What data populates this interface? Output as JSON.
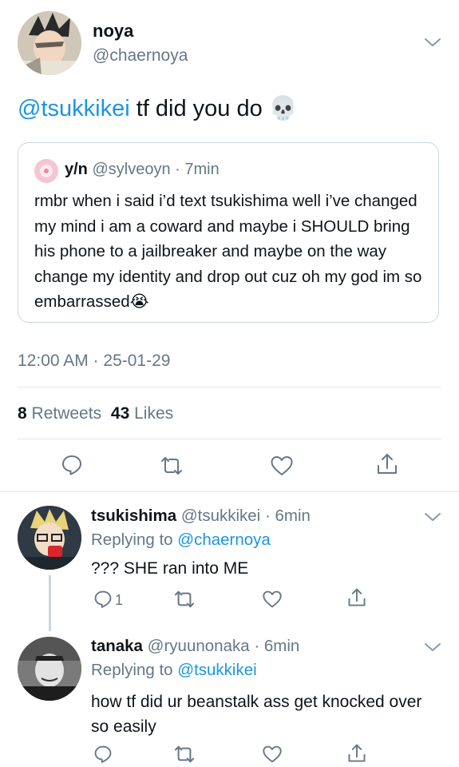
{
  "main_tweet": {
    "display_name": "noya",
    "handle": "@chaernoya",
    "mention": "@tsukkikei",
    "text": " tf did you do 💀",
    "timestamp": "12:00 AM · 25-01-29",
    "retweets_count": "8",
    "retweets_label": "Retweets",
    "likes_count": "43",
    "likes_label": "Likes",
    "quoted": {
      "display_name": "y/n",
      "handle": "@sylveoyn",
      "time": "· 7min",
      "text": "rmbr when i said i’d text tsukishima well i’ve changed my mind i am a coward and maybe i SHOULD bring his phone to a jailbreaker and maybe on the way change my identity and drop out cuz oh my god im so embarrassed😭"
    }
  },
  "replies": [
    {
      "display_name": "tsukishima",
      "handle": "@tsukkikei",
      "time": "· 6min",
      "replying_prefix": "Replying to ",
      "replying_to": "@chaernoya",
      "text": "??? SHE ran into ME",
      "reply_count": "1"
    },
    {
      "display_name": "tanaka",
      "handle": "@ryuunonaka",
      "time": "· 6min",
      "replying_prefix": "Replying to ",
      "replying_to": "@tsukkikei",
      "text": "how tf did ur beanstalk ass get knocked over so easily",
      "reply_count": ""
    }
  ],
  "colors": {
    "link": "#1b95e0",
    "secondary": "#657786",
    "divider": "#e1e8ed"
  }
}
